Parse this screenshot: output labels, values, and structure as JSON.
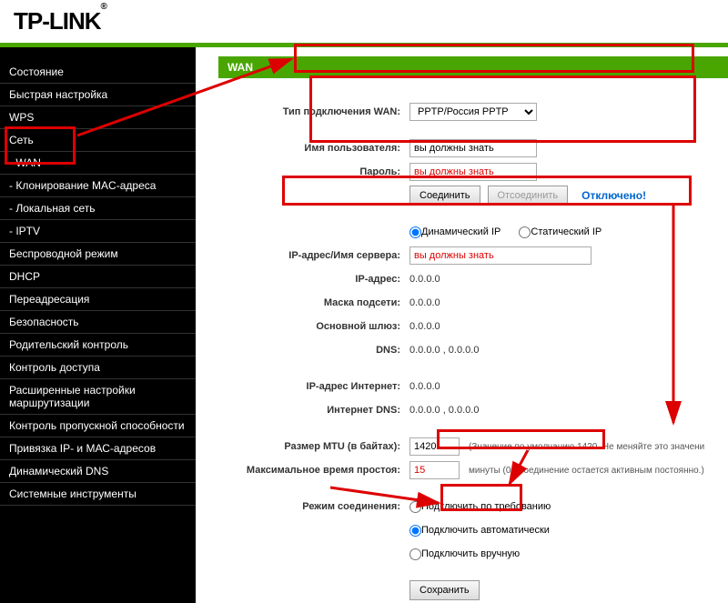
{
  "brand": "TP-LINK",
  "sidebar": {
    "items": [
      "Состояние",
      "Быстрая настройка",
      "WPS",
      "Сеть",
      "- WAN",
      "- Клонирование MAC-адреса",
      "- Локальная сеть",
      "- IPTV",
      "Беспроводной режим",
      "DHCP",
      "Переадресация",
      "Безопасность",
      "Родительский контроль",
      "Контроль доступа",
      "Расширенные настройки маршрутизации",
      "Контроль пропускной способности",
      "Привязка IP- и МАС-адресов",
      "Динамический DNS",
      "Системные инструменты"
    ]
  },
  "page": {
    "title": "WAN"
  },
  "wan": {
    "type_label": "Тип подключения WAN:",
    "type_value": "PPTP/Россия PPTP",
    "user_label": "Имя пользователя:",
    "user_value": "вы должны знать",
    "pass_label": "Пароль:",
    "pass_value": "вы должны знать",
    "connect_btn": "Соединить",
    "disconnect_btn": "Отсоединить",
    "status": "Отключено!",
    "dyn_label": "Динамический IP",
    "stat_label": "Статический IP",
    "server_label": "IP-адрес/Имя сервера:",
    "server_value": "вы должны знать",
    "ip_label": "IP-адрес:",
    "ip_value": "0.0.0.0",
    "mask_label": "Маска подсети:",
    "mask_value": "0.0.0.0",
    "gw_label": "Основной шлюз:",
    "gw_value": "0.0.0.0",
    "dns_label": "DNS:",
    "dns_value": "0.0.0.0 , 0.0.0.0",
    "inetip_label": "IP-адрес Интернет:",
    "inetip_value": "0.0.0.0",
    "inetdns_label": "Интернет DNS:",
    "inetdns_value": "0.0.0.0 , 0.0.0.0",
    "mtu_label": "Размер MTU (в байтах):",
    "mtu_value": "1420",
    "mtu_hint": "(Значение по умолчанию 1420. Не меняйте это значени",
    "idle_label": "Максимальное время простоя:",
    "idle_value": "15",
    "idle_hint": "минуты (0 - соединение остается активным постоянно.)",
    "mode_label": "Режим соединения:",
    "mode_demand": "Подключить по требованию",
    "mode_auto": "Подключить автоматически",
    "mode_manual": "Подключить вручную",
    "save_btn": "Сохранить"
  }
}
